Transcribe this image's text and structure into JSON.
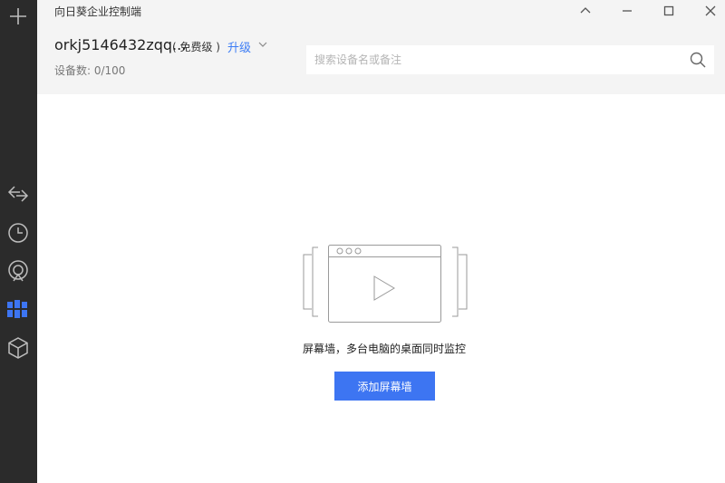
{
  "app": {
    "title": "向日葵企业控制端"
  },
  "account": {
    "name": "orkj5146432zqq...",
    "plan": "( 免费级 )",
    "upgrade_label": "升级",
    "device_count": "设备数: 0/100"
  },
  "search": {
    "placeholder": "搜索设备名或备注"
  },
  "sidebar": {
    "items": [
      {
        "icon": "add-icon"
      },
      {
        "icon": "remote-control-icon"
      },
      {
        "icon": "history-clock-icon"
      },
      {
        "icon": "discovery-icon"
      },
      {
        "icon": "screen-wall-icon",
        "active": true
      },
      {
        "icon": "cube-icon"
      }
    ]
  },
  "window_controls": [
    "collapse-icon",
    "minimize-icon",
    "maximize-icon",
    "close-icon"
  ],
  "empty_state": {
    "message": "屏幕墙，多台电脑的桌面同时监控",
    "button_label": "添加屏幕墙"
  },
  "colors": {
    "accent": "#3d75f2",
    "rail": "#2b2b2b",
    "header": "#f4f4f4"
  }
}
